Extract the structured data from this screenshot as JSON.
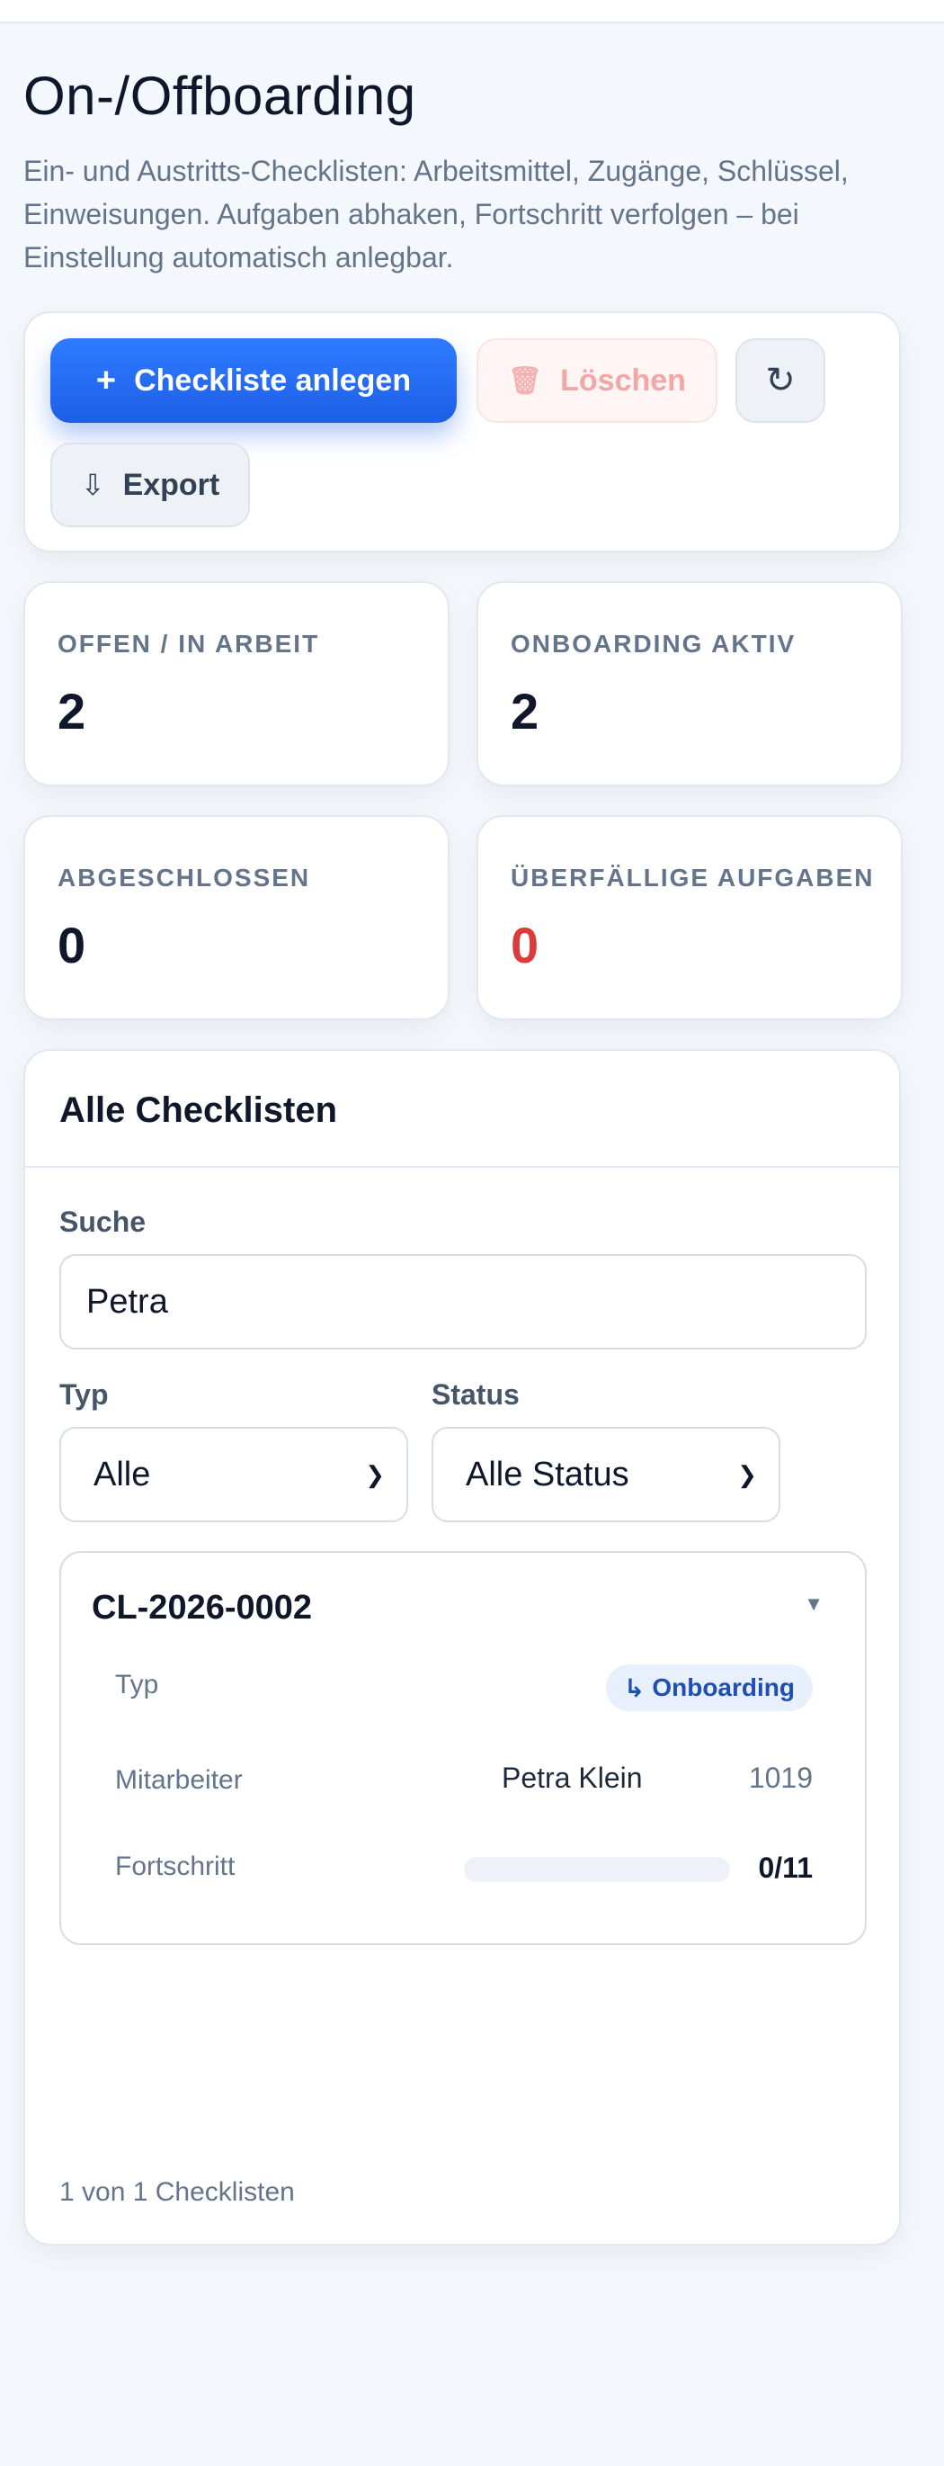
{
  "page": {
    "title": "On-/Offboarding",
    "description": "Ein- und Austritts-Checklisten: Arbeitsmittel, Zugänge, Schlüssel, Einweisungen. Aufgaben abhaken, Fortschritt verfolgen – bei Einstellung automatisch anlegbar."
  },
  "toolbar": {
    "create_label": "Checkliste anlegen",
    "create_icon": "+",
    "delete_label": "Löschen",
    "delete_icon": "🗑",
    "refresh_icon": "↻",
    "export_label": "Export",
    "export_icon": "⇩"
  },
  "stats": {
    "open_label": "OFFEN / IN ARBEIT",
    "open_value": "2",
    "onboarding_label": "ONBOARDING AKTIV",
    "onboarding_value": "2",
    "done_label": "ABGESCHLOSSEN",
    "done_value": "0",
    "overdue_label": "ÜBERFÄLLIGE AUFGABEN",
    "overdue_value": "0"
  },
  "list": {
    "title": "Alle Checklisten",
    "search_label": "Suche",
    "search_value": "Petra",
    "type_label": "Typ",
    "type_value": "Alle",
    "status_label": "Status",
    "status_value": "Alle Status",
    "footer": "1 von 1 Checklisten",
    "items": [
      {
        "id": "CL-2026-0002",
        "type_label": "Typ",
        "type_icon": "↳",
        "type_value": "Onboarding",
        "employee_label": "Mitarbeiter",
        "employee_name": "Petra Klein",
        "employee_no": "1019",
        "progress_label": "Fortschritt",
        "progress_text": "0/11",
        "progress_fraction": 0
      }
    ]
  },
  "colors": {
    "accent": "#2563eb",
    "danger": "#dc3b3b",
    "background": "#f4f7fb"
  }
}
